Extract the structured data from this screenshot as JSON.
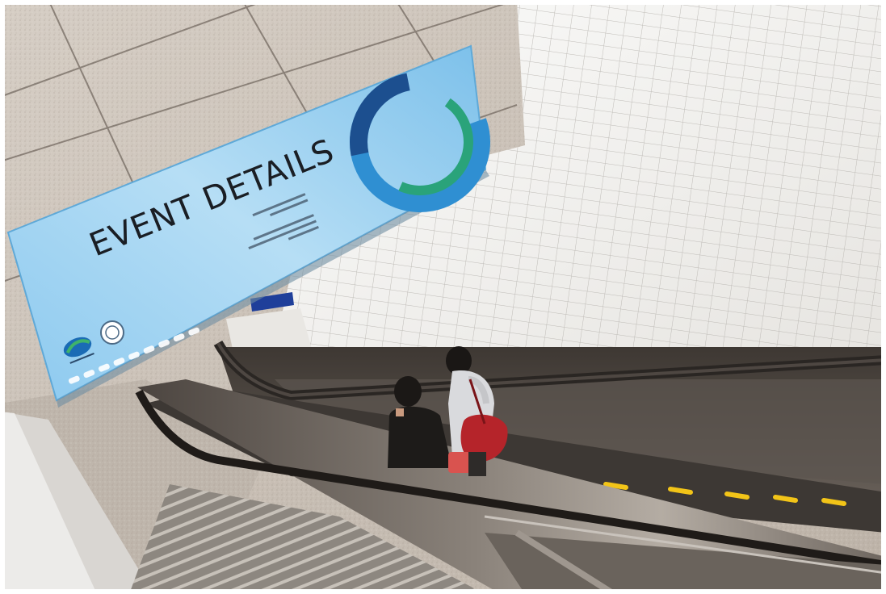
{
  "sign": {
    "headline": "EVENT DETAILS"
  },
  "colors": {
    "sign_background": "#a9d6f2",
    "ring_dark_blue": "#1c4f8f",
    "ring_blue": "#2f8fd2",
    "ring_green": "#2aa37a",
    "headline_text": "#1a1e24",
    "escalator_steel": "#7c756e",
    "step_edge_yellow": "#f2c418"
  },
  "icons": {
    "logo": "organization-logo-icon",
    "seal": "circular-seal-icon",
    "ring": "ring-emblem-icon",
    "partner_row": "partner-logos-row"
  }
}
